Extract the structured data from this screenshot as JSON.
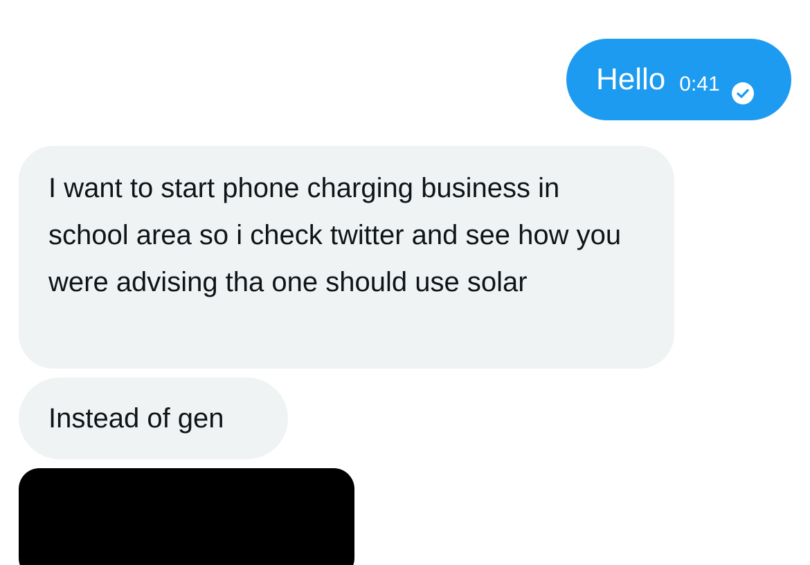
{
  "conversation": {
    "sent": {
      "text": "Hello",
      "time": "0:41",
      "status_icon": "check-circle-icon",
      "bubble_color": "#1d9bf0"
    },
    "received": [
      {
        "text": "I want to start phone charging business in school area so i check twitter and see how you were advising tha one should use solar"
      },
      {
        "text": "Instead of gen"
      }
    ],
    "received_bubble_color": "#eff3f4",
    "media_color": "#000000"
  }
}
